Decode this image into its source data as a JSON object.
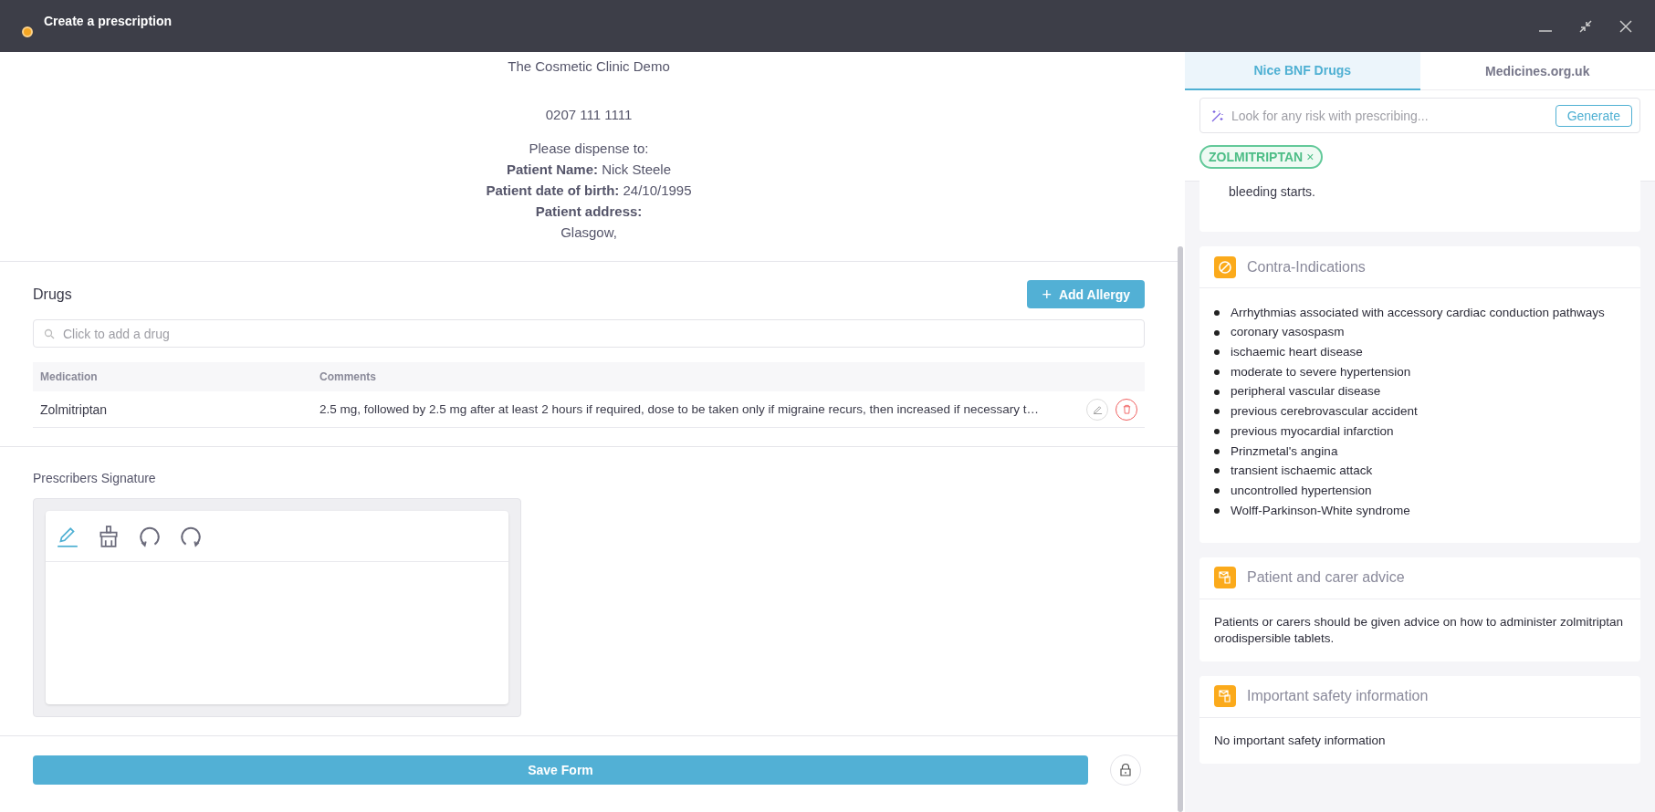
{
  "window": {
    "title": "Create a prescription"
  },
  "prescription_header": {
    "clinic": "The Cosmetic Clinic Demo",
    "phone": "0207 111 1111",
    "dispense_label": "Please dispense to:",
    "lines": [
      {
        "label": "Patient Name:",
        "value": "Nick Steele"
      },
      {
        "label": "Patient date of birth:",
        "value": "24/10/1995"
      },
      {
        "label": "Patient address:"
      }
    ],
    "address": "Glasgow,"
  },
  "drugs": {
    "title": "Drugs",
    "add_button": "Add Allergy",
    "add_icon": "+",
    "search_placeholder": "Click to add a drug",
    "columns": [
      "Medication",
      "Comments"
    ],
    "rows": [
      {
        "medication": "Zolmitriptan",
        "comments": "2.5 mg, followed by 2.5 mg after at least 2 hours if required, dose to be taken only if migraine recurs, then increased if necessary t…"
      }
    ]
  },
  "signature": {
    "label": "Prescribers Signature",
    "tools": [
      {
        "kind": "pen",
        "selected": true
      },
      {
        "kind": "eraser",
        "selected": false
      },
      {
        "kind": "undo",
        "selected": false
      },
      {
        "kind": "redo",
        "selected": false
      }
    ]
  },
  "save_button": "Save Form",
  "side_panel": {
    "tabs": [
      {
        "label": "Nice BNF Drugs",
        "selected": true
      },
      {
        "label": "Medicines.org.uk",
        "selected": false
      }
    ],
    "risk_search": {
      "placeholder": "Look for any risk with prescribing...",
      "button": "Generate"
    },
    "chips": [
      {
        "label": "ZOLMITRIPTAN",
        "remove": "×"
      }
    ],
    "sections": [
      {
        "kind": "partial",
        "text": "bleeding starts."
      },
      {
        "kind": "list",
        "title": "Contra-Indications",
        "items": [
          "Arrhythmias associated with accessory cardiac conduction pathways",
          "coronary vasospasm",
          "ischaemic heart disease",
          "moderate to severe hypertension",
          "peripheral vascular disease",
          "previous cerebrovascular accident",
          "previous myocardial infarction",
          "Prinzmetal's angina",
          "transient ischaemic attack",
          "uncontrolled hypertension",
          "Wolff-Parkinson-White syndrome"
        ]
      },
      {
        "kind": "text",
        "title": "Patient and carer advice",
        "text": "Patients or carers should be given advice on how to administer zolmitriptan orodispersible tablets."
      },
      {
        "kind": "text",
        "title": "Important safety information",
        "text": "No important safety information"
      }
    ]
  }
}
